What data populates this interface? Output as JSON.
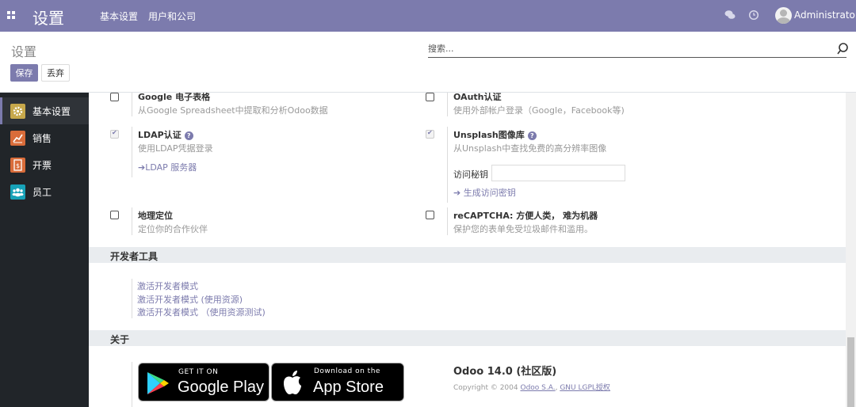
{
  "topbar": {
    "app_title": "设置",
    "menu": [
      "基本设置",
      "用户和公司"
    ],
    "user": "Administrator"
  },
  "control_panel": {
    "title": "设置",
    "search_placeholder": "搜索...",
    "save_label": "保存",
    "discard_label": "丢弃"
  },
  "sidebar": {
    "items": [
      {
        "label": "基本设置",
        "icon": "gear-icon",
        "color": "#c7a84b"
      },
      {
        "label": "销售",
        "icon": "chart-icon",
        "color": "#d96c3a"
      },
      {
        "label": "开票",
        "icon": "invoice-icon",
        "color": "#d96c3a"
      },
      {
        "label": "员工",
        "icon": "people-icon",
        "color": "#17a2b8"
      }
    ]
  },
  "settings": {
    "google_sheets": {
      "title": "Google 电子表格",
      "desc": "从Google Spreadsheet中提取和分析Odoo数据",
      "checked": false
    },
    "oauth": {
      "title": "OAuth认证",
      "desc": "使用外部帐户登录（Google，Facebook等)",
      "checked": false
    },
    "ldap": {
      "title": "LDAP认证",
      "desc": "使用LDAP凭据登录",
      "link": "LDAP 服务器",
      "checked": true
    },
    "unsplash": {
      "title": "Unsplash图像库",
      "desc": "从Unsplash中查找免费的高分辨率图像",
      "field_label": "访问秘钥",
      "field_value": "",
      "link": "生成访问密钥",
      "checked": true
    },
    "geo": {
      "title": "地理定位",
      "desc": "定位你的合作伙伴",
      "checked": false
    },
    "recaptcha": {
      "title": "reCAPTCHA: 方便人类， 难为机器",
      "desc": "保护您的表单免受垃圾邮件和滥用。",
      "checked": false
    }
  },
  "developer": {
    "heading": "开发者工具",
    "links": [
      "激活开发者模式",
      "激活开发者模式 (使用资源)",
      "激活开发者模式 （使用资源测试)"
    ]
  },
  "about": {
    "heading": "关于",
    "google_play_small": "GET IT ON",
    "google_play_big": "Google Play",
    "app_store_small": "Download on the",
    "app_store_big": "App Store",
    "version": "Odoo 14.0 (社区版)",
    "copyright_prefix": "Copyright © 2004",
    "company_link": "Odoo S.A.",
    "license_link": "GNU LGPL授权"
  },
  "colors": {
    "brand": "#7c7bad",
    "sidebar": "#212529"
  }
}
